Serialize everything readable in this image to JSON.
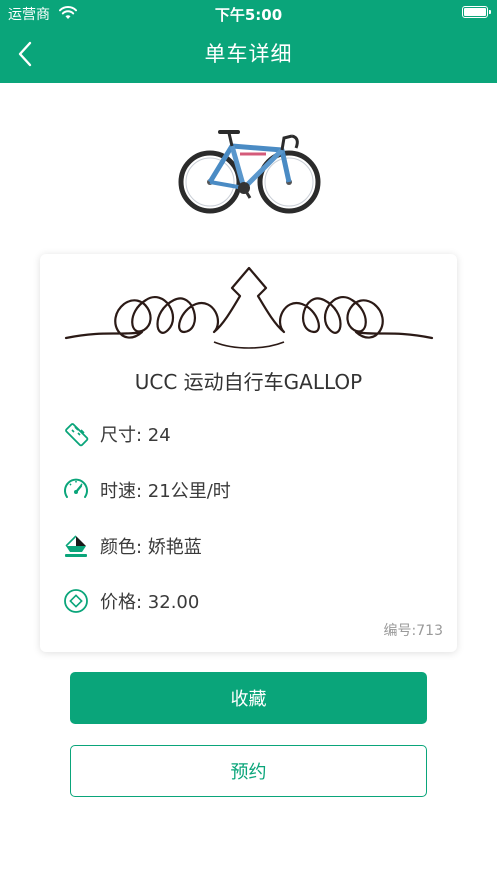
{
  "status_bar": {
    "carrier": "运营商",
    "time": "下午5:00"
  },
  "nav": {
    "title": "单车详细",
    "back_icon": "chevron-left-icon"
  },
  "bike": {
    "image": "bicycle-image",
    "name": "UCC 运动自行车GALLOP",
    "specs": [
      {
        "icon": "ruler-icon",
        "text": "尺寸: 24"
      },
      {
        "icon": "speedometer-icon",
        "text": "时速: 21公里/时"
      },
      {
        "icon": "paint-bucket-icon",
        "text": "颜色: 娇艳蓝"
      },
      {
        "icon": "price-tag-icon",
        "text": "价格: 32.00"
      }
    ],
    "serial": "编号:713"
  },
  "actions": {
    "favorite_label": "收藏",
    "reserve_label": "预约"
  },
  "colors": {
    "brand": "#0aa57a",
    "text": "#333333",
    "muted": "#9a9a9a"
  }
}
